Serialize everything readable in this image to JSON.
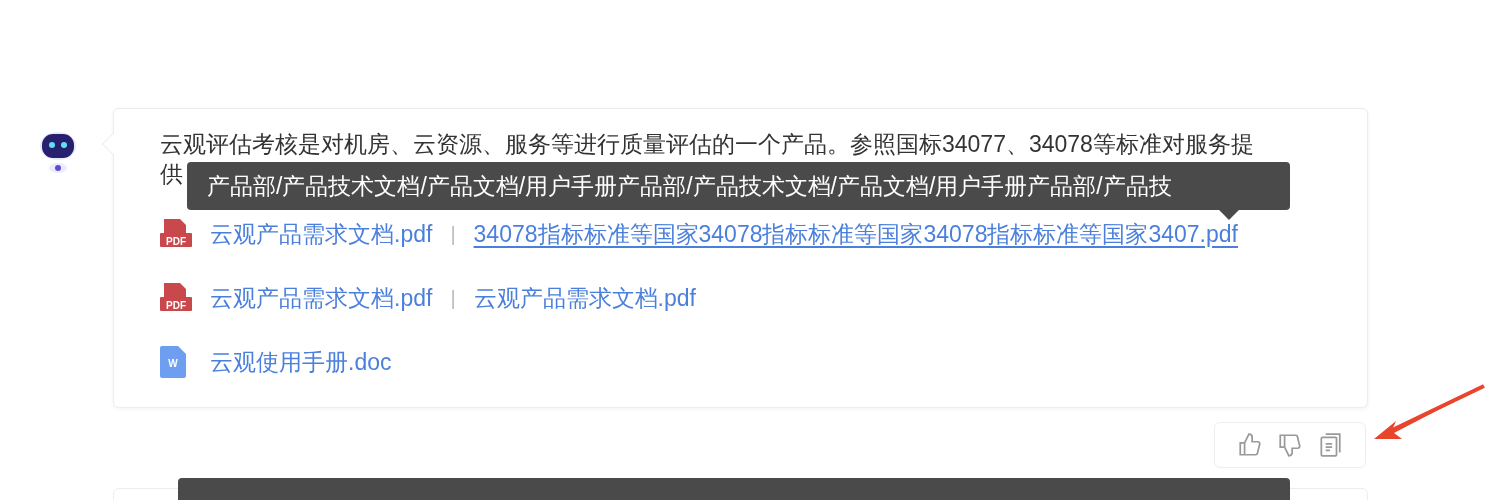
{
  "message": {
    "paragraph_lines": [
      "云观评估考核是对机房、云资源、服务等进行质量评估的一个产品。参照国标34077、34078等标准对服务提",
      "供"
    ],
    "tooltip": "产品部/产品技术文档/产品文档/用户手册产品部/产品技术文档/产品文档/用户手册产品部/产品技",
    "attachment_rows": [
      {
        "kind": "pdf",
        "icon_label": "PDF",
        "links": [
          {
            "text": "云观产品需求文档.pdf",
            "hovered": false
          },
          {
            "text": "34078指标标准等国家34078指标标准等国家34078指标标准等国家3407.pdf",
            "hovered": true
          }
        ]
      },
      {
        "kind": "pdf",
        "icon_label": "PDF",
        "links": [
          {
            "text": "云观产品需求文档.pdf",
            "hovered": false
          },
          {
            "text": "云观产品需求文档.pdf",
            "hovered": false
          }
        ]
      },
      {
        "kind": "doc",
        "icon_label": "W",
        "links": [
          {
            "text": "云观使用手册.doc",
            "hovered": false
          }
        ]
      }
    ],
    "separator": "|"
  }
}
